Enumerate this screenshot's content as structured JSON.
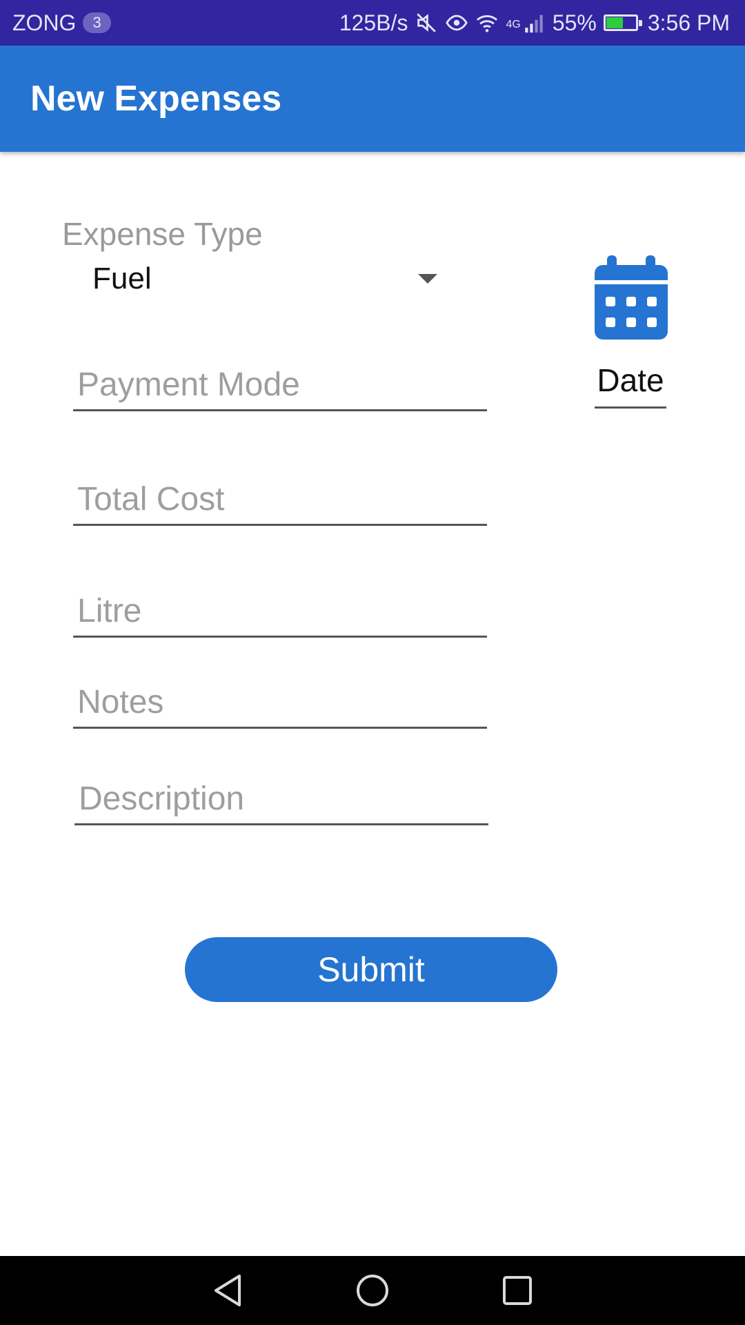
{
  "status_bar": {
    "carrier": "ZONG",
    "carrier_badge": "3",
    "network_speed": "125B/s",
    "network_type": "4G",
    "battery_percent": "55%",
    "battery_level": 0.55,
    "time": "3:56 PM",
    "icons": [
      "mute-icon",
      "eye-icon",
      "wifi-icon",
      "signal-icon",
      "battery-icon"
    ]
  },
  "app_bar": {
    "title": "New Expenses"
  },
  "form": {
    "expense_type_label": "Expense Type",
    "expense_type_value": "Fuel",
    "payment_mode_placeholder": "Payment Mode",
    "total_cost_placeholder": "Total Cost",
    "litre_placeholder": "Litre",
    "notes_placeholder": "Notes",
    "description_placeholder": "Description",
    "date_label": "Date",
    "date_icon": "calendar-icon",
    "submit_label": "Submit"
  },
  "nav_bar": {
    "icons": [
      "back-icon",
      "home-icon",
      "recents-icon"
    ]
  },
  "colors": {
    "status_bar": "#3126a0",
    "primary": "#2574d1",
    "hint_text": "#9e9e9e",
    "nav_bar": "#000000"
  }
}
